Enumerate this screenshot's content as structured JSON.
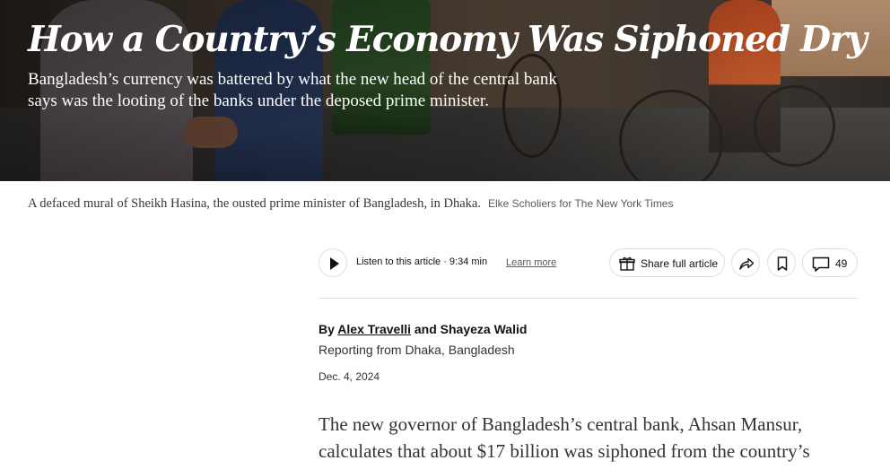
{
  "hero": {
    "headline": "How a Country’s Economy Was Siphoned Dry",
    "dek": "Bangladesh’s currency was battered by what the new head of the central bank says was the looting of the banks under the deposed prime minister."
  },
  "caption": {
    "text": "A defaced mural of Sheikh Hasina, the ousted prime minister of Bangladesh, in Dhaka.",
    "credit": "Elke Scholiers for The New York Times"
  },
  "toolbar": {
    "listen_label": "Listen to this article · 9:34 min",
    "learn_more": "Learn more",
    "share_full_label": "Share full article",
    "comments_count": "49"
  },
  "byline": {
    "prefix": "By ",
    "author1": "Alex Travelli",
    "joiner": " and ",
    "author2": "Shayeza Walid",
    "dateline": "Reporting from Dhaka, Bangladesh",
    "date": "Dec. 4, 2024"
  },
  "article": {
    "first_paragraph": "The new governor of Bangladesh’s central bank, Ahsan Mansur, calculates that about $17 billion was siphoned from the country’s"
  },
  "icons": {
    "play": "play-icon",
    "gift": "gift-icon",
    "share": "share-arrow-icon",
    "bookmark": "bookmark-icon",
    "comment": "comment-icon"
  },
  "colors": {
    "text": "#121212",
    "muted": "#5a5a5a",
    "border": "#dfdfdf"
  }
}
